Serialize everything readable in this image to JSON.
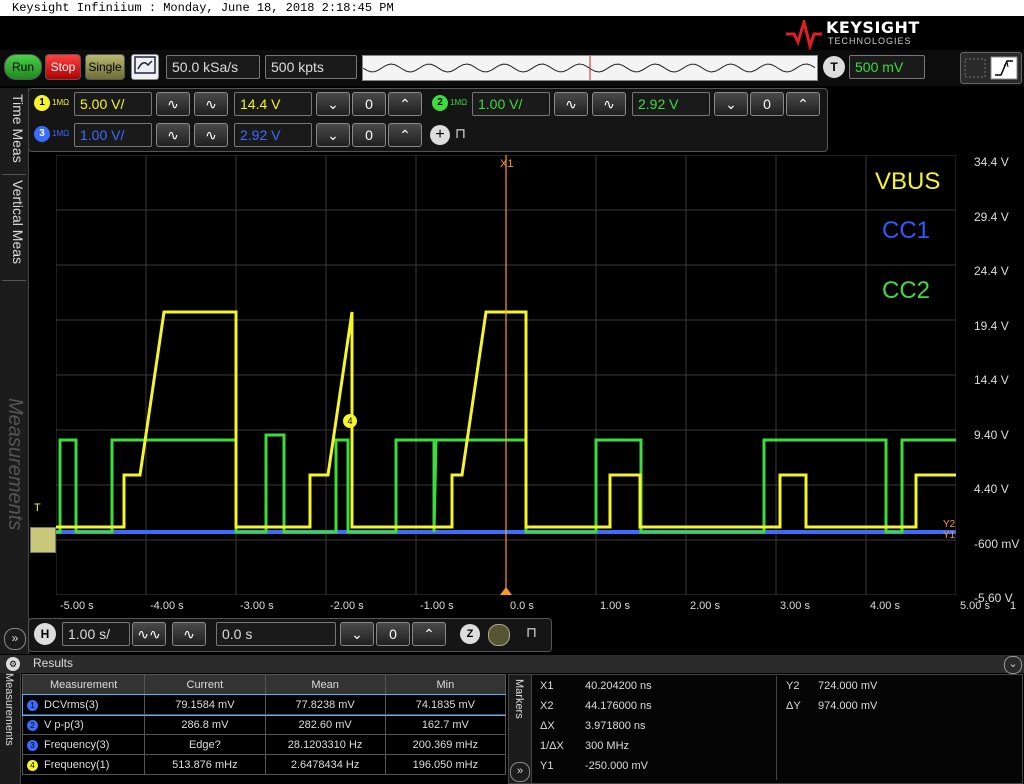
{
  "title_bar": "Keysight Infiniium : Monday, June 18, 2018 2:18:45 PM",
  "brand": {
    "name": "KEYSIGHT",
    "sub": "TECHNOLOGIES"
  },
  "toolbar": {
    "run": "Run",
    "stop": "Stop",
    "single": "Single",
    "sample_rate": "50.0 kSa/s",
    "memory_depth": "500 kpts",
    "trigger_label": "T",
    "trigger_level": "500 mV"
  },
  "channels": {
    "ch1": {
      "num": "1",
      "impedance": "1MΩ",
      "scale": "5.00 V/",
      "offset": "14.4 V",
      "color": "#f5f52a"
    },
    "ch2": {
      "num": "2",
      "impedance": "1MΩ",
      "scale": "1.00 V/",
      "offset": "2.92 V",
      "color": "#3cdc3c"
    },
    "ch3": {
      "num": "3",
      "impedance": "1MΩ",
      "scale": "1.00 V/",
      "offset": "2.92 V",
      "color": "#3a6cff"
    }
  },
  "side_tabs": [
    "Time Meas",
    "Vertical Meas",
    "Measurements"
  ],
  "plot": {
    "cursor_label": "X1",
    "y_ticks": [
      "34.4 V",
      "29.4 V",
      "24.4 V",
      "19.4 V",
      "14.4 V",
      "9.40 V",
      "4.40 V",
      "-600 mV",
      "-5.60 V"
    ],
    "x_ticks": [
      "-5.00 s",
      "-4.00 s",
      "-3.00 s",
      "-2.00 s",
      "-1.00 s",
      "0.0 s",
      "1.00 s",
      "2.00 s",
      "3.00 s",
      "4.00 s",
      "5.00 s"
    ],
    "right_index": "1",
    "legend": [
      {
        "label": "VBUS",
        "color": "#f5f52a"
      },
      {
        "label": "CC1",
        "color": "#2a5cff"
      },
      {
        "label": "CC2",
        "color": "#3cdc3c"
      }
    ],
    "marker_y2": "Y2",
    "marker_y1": "Y1",
    "trigger_marker": "T",
    "ch4_marker": "4"
  },
  "horizontal": {
    "label": "H",
    "scale": "1.00 s/",
    "position": "0.0 s"
  },
  "results": {
    "title": "Results",
    "side_label": "Measurements",
    "markers_label": "Markers",
    "columns": [
      "Measurement",
      "Current",
      "Mean",
      "Min"
    ],
    "rows": [
      {
        "icon": "1",
        "icon_color": "#3a6cff",
        "name": "DCVrms(3)",
        "current": "79.1584 mV",
        "mean": "77.8238 mV",
        "min": "74.1835 mV"
      },
      {
        "icon": "2",
        "icon_color": "#3a6cff",
        "name": "V p-p(3)",
        "current": "286.8 mV",
        "mean": "282.60 mV",
        "min": "162.7 mV"
      },
      {
        "icon": "3",
        "icon_color": "#3a6cff",
        "name": "Frequency(3)",
        "current": "Edge?",
        "mean": "28.1203310 Hz",
        "min": "200.369 mHz"
      },
      {
        "icon": "4",
        "icon_color": "#f5f52a",
        "name": "Frequency(1)",
        "current": "513.876 mHz",
        "mean": "2.6478434 Hz",
        "min": "196.050 mHz"
      }
    ]
  },
  "markers": {
    "x1_label": "X1",
    "x1": "40.204200 ns",
    "x2_label": "X2",
    "x2": "44.176000 ns",
    "dx_label": "ΔX",
    "dx": "3.971800 ns",
    "inv_dx_label": "1/ΔX",
    "inv_dx": "300 MHz",
    "y1_label": "Y1",
    "y1": "-250.000 mV",
    "y2_label": "Y2",
    "y2": "724.000 mV",
    "dy_label": "ΔY",
    "dy": "974.000 mV"
  }
}
